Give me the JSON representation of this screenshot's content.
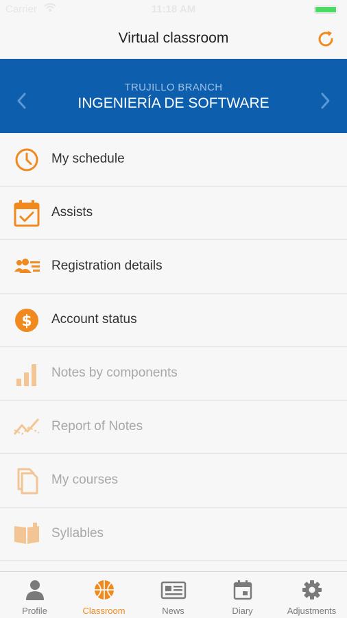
{
  "status_bar": {
    "carrier": "Carrier",
    "time": "11:18 AM"
  },
  "header": {
    "title": "Virtual classroom",
    "refresh_icon": "refresh-icon"
  },
  "banner": {
    "subtitle": "TRUJILLO BRANCH",
    "title": "INGENIERÍA DE SOFTWARE"
  },
  "menu": {
    "items": [
      {
        "label": "My schedule",
        "icon": "clock-icon",
        "enabled": true
      },
      {
        "label": "Assists",
        "icon": "calendar-check-icon",
        "enabled": true
      },
      {
        "label": "Registration details",
        "icon": "users-list-icon",
        "enabled": true
      },
      {
        "label": "Account status",
        "icon": "dollar-icon",
        "enabled": true
      },
      {
        "label": "Notes by components",
        "icon": "bar-chart-icon",
        "enabled": false
      },
      {
        "label": "Report of Notes",
        "icon": "trend-line-icon",
        "enabled": false
      },
      {
        "label": "My courses",
        "icon": "documents-icon",
        "enabled": false
      },
      {
        "label": "Syllables",
        "icon": "open-book-icon",
        "enabled": false
      }
    ]
  },
  "tabs": [
    {
      "label": "Profile",
      "icon": "person-icon",
      "active": false
    },
    {
      "label": "Classroom",
      "icon": "basketball-icon",
      "active": true
    },
    {
      "label": "News",
      "icon": "newspaper-icon",
      "active": false
    },
    {
      "label": "Diary",
      "icon": "calendar-icon",
      "active": false
    },
    {
      "label": "Adjustments",
      "icon": "gear-icon",
      "active": false
    }
  ],
  "colors": {
    "accent": "#f08a1e",
    "banner": "#0d5fae",
    "tab_inactive": "#7a7a7a"
  }
}
